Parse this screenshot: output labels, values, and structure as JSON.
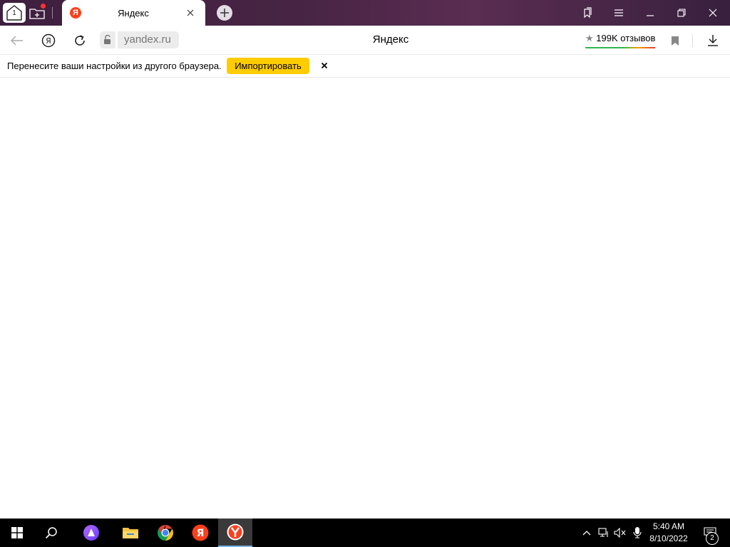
{
  "titlebar": {
    "home_count": "1",
    "tab": {
      "favicon": "Я",
      "title": "Яндекс"
    },
    "icons": [
      "home-icon",
      "new-tab-group-icon",
      "close-icon",
      "plus-icon",
      "bookmarks-panel-icon",
      "menu-icon",
      "minimize-icon",
      "restore-icon",
      "window-close-icon"
    ]
  },
  "toolbar": {
    "url": "yandex.ru",
    "page_title": "Яндекс",
    "reviews": "199K отзывов",
    "icons": [
      "back-arrow-icon",
      "yandex-logo-icon",
      "reload-icon",
      "lock-icon",
      "star-icon",
      "bookmark-icon",
      "download-icon"
    ]
  },
  "infobar": {
    "message": "Перенесите ваши настройки из другого браузера.",
    "button_label": "Импортировать",
    "close_symbol": "×"
  },
  "taskbar": {
    "time": "5:40 AM",
    "date": "8/10/2022",
    "notifications": "2",
    "apps": [
      "start-windows-icon",
      "search-icon",
      "alice-icon",
      "file-explorer-icon",
      "chrome-icon",
      "yandex-icon",
      "yandex-browser-icon"
    ],
    "tray": [
      "chevron-up-icon",
      "network-icon",
      "mute-icon",
      "microphone-icon",
      "notification-icon"
    ]
  },
  "colors": {
    "titlebar_gradient": [
      "#3f1f3f",
      "#5a2d52"
    ],
    "import_button": "#ffcc00",
    "yandex_red": "#fc3f1d",
    "taskbar": "#000000"
  }
}
